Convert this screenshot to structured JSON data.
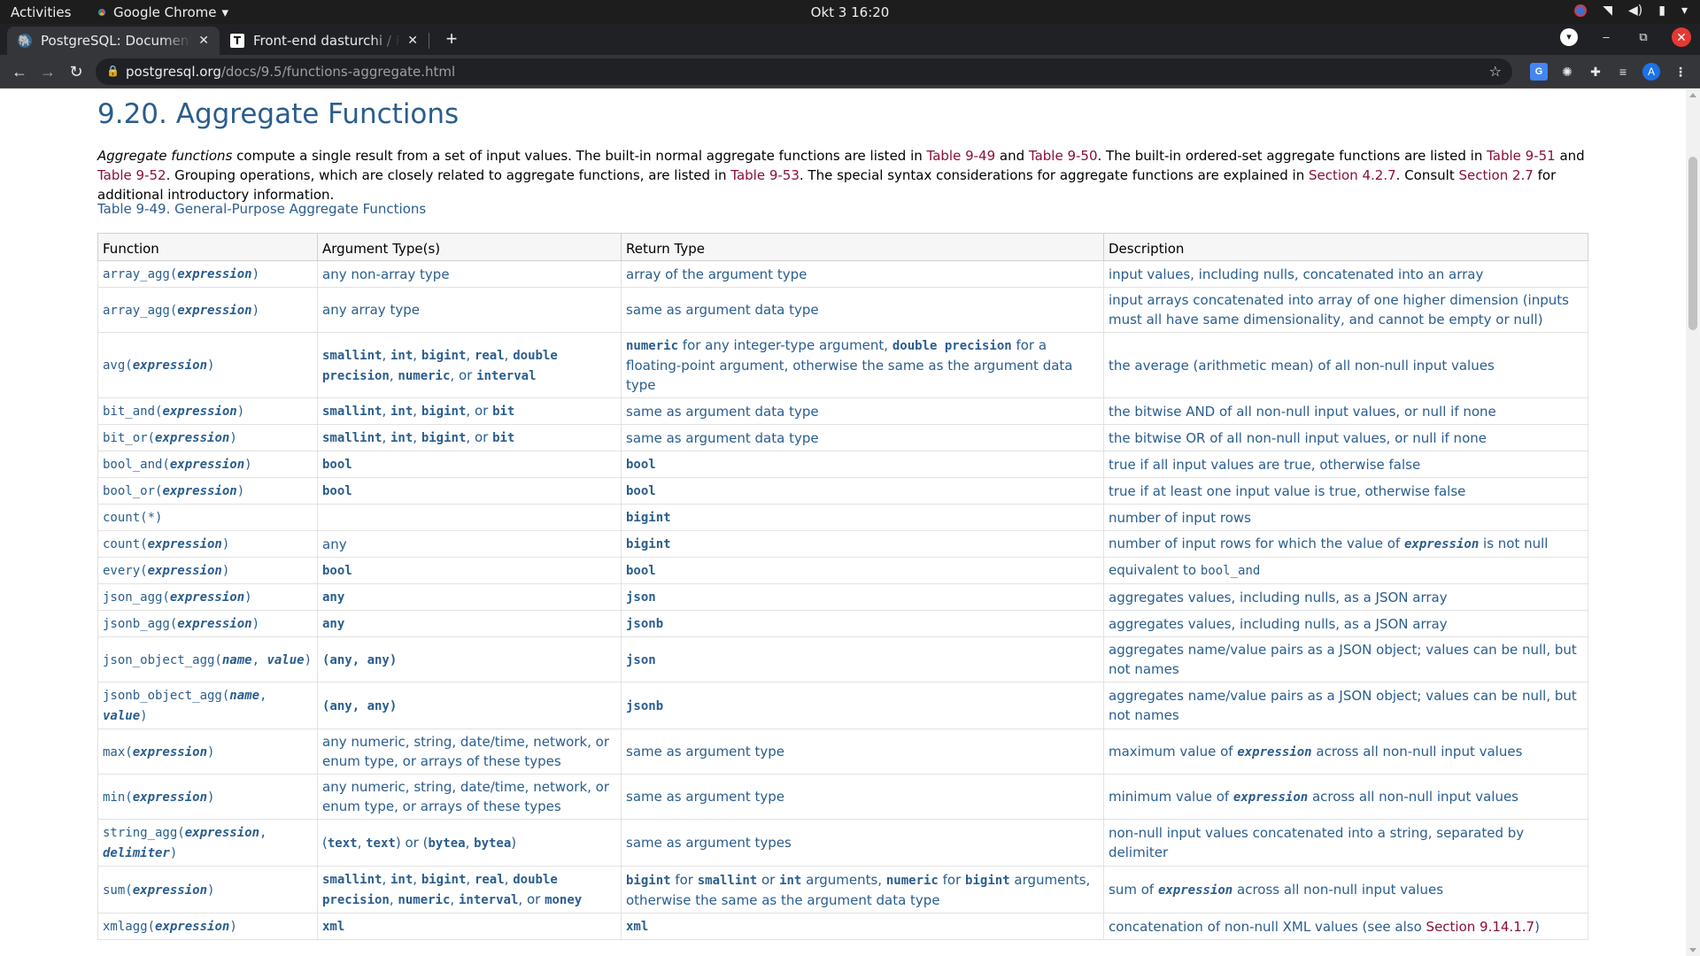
{
  "system_bar": {
    "activities": "Activities",
    "app_name": "Google Chrome",
    "app_caret": "▾",
    "clock": "Okt 3  16:20"
  },
  "tabs": [
    {
      "label": "PostgreSQL: Documentation",
      "favicon": "postgresql-elephant-icon",
      "active": true
    },
    {
      "label": "Front-end dasturchi / Front",
      "favicon": "t-letter-icon",
      "active": false
    }
  ],
  "toolbar": {
    "url_host": "postgresql.org",
    "url_path": "/docs/9.5/functions-aggregate.html"
  },
  "colors": {
    "title": "#2a5d8e",
    "link": "#8b0e3a",
    "chrome_dark": "#202124",
    "chrome_toolbar": "#35363a"
  },
  "page": {
    "title": "9.20. Aggregate Functions",
    "intro": {
      "term": "Aggregate functions",
      "t1": " compute a single result from a set of input values. The built-in normal aggregate functions are listed in ",
      "l1": "Table 9-49",
      "t2": " and ",
      "l2": "Table 9-50",
      "t3": ". The built-in ordered-set aggregate functions are listed in ",
      "l3": "Table 9-51",
      "t4": " and ",
      "l4": "Table 9-52",
      "t5": ". Grouping operations, which are closely related to aggregate functions, are listed in ",
      "l5": "Table 9-53",
      "t6": ". The special syntax considerations for aggregate functions are explained in ",
      "l6": "Section 4.2.7",
      "t7": ". Consult ",
      "l7": "Section 2.7",
      "t8": " for additional introductory information."
    },
    "table_caption": "Table 9-49. General-Purpose Aggregate Functions",
    "columns": [
      "Function",
      "Argument Type(s)",
      "Return Type",
      "Description"
    ],
    "rows": [
      {
        "fn": [
          [
            "m",
            "array_agg("
          ],
          [
            "a",
            "expression"
          ],
          [
            "m",
            ")"
          ]
        ],
        "arg": [
          [
            "t",
            "any non-array type"
          ]
        ],
        "ret": [
          [
            "t",
            "array of the argument type"
          ]
        ],
        "desc": [
          [
            "t",
            "input values, including nulls, concatenated into an array"
          ]
        ]
      },
      {
        "fn": [
          [
            "m",
            "array_agg("
          ],
          [
            "a",
            "expression"
          ],
          [
            "m",
            ")"
          ]
        ],
        "arg": [
          [
            "t",
            "any array type"
          ]
        ],
        "ret": [
          [
            "t",
            "same as argument data type"
          ]
        ],
        "desc": [
          [
            "t",
            "input arrays concatenated into array of one higher dimension (inputs must all have same dimensionality, and cannot be empty or null)"
          ]
        ]
      },
      {
        "fn": [
          [
            "m",
            "avg("
          ],
          [
            "a",
            "expression"
          ],
          [
            "m",
            ")"
          ]
        ],
        "arg": [
          [
            "b",
            "smallint"
          ],
          [
            "t",
            ", "
          ],
          [
            "b",
            "int"
          ],
          [
            "t",
            ", "
          ],
          [
            "b",
            "bigint"
          ],
          [
            "t",
            ", "
          ],
          [
            "b",
            "real"
          ],
          [
            "t",
            ", "
          ],
          [
            "b",
            "double precision"
          ],
          [
            "t",
            ", "
          ],
          [
            "b",
            "numeric"
          ],
          [
            "t",
            ", or "
          ],
          [
            "b",
            "interval"
          ]
        ],
        "ret": [
          [
            "b",
            "numeric"
          ],
          [
            "t",
            " for any integer-type argument, "
          ],
          [
            "b",
            "double precision"
          ],
          [
            "t",
            " for a floating-point argument, otherwise the same as the argument data type"
          ]
        ],
        "desc": [
          [
            "t",
            "the average (arithmetic mean) of all non-null input values"
          ]
        ]
      },
      {
        "fn": [
          [
            "m",
            "bit_and("
          ],
          [
            "a",
            "expression"
          ],
          [
            "m",
            ")"
          ]
        ],
        "arg": [
          [
            "b",
            "smallint"
          ],
          [
            "t",
            ", "
          ],
          [
            "b",
            "int"
          ],
          [
            "t",
            ", "
          ],
          [
            "b",
            "bigint"
          ],
          [
            "t",
            ", or "
          ],
          [
            "b",
            "bit"
          ]
        ],
        "ret": [
          [
            "t",
            "same as argument data type"
          ]
        ],
        "desc": [
          [
            "t",
            "the bitwise AND of all non-null input values, or null if none"
          ]
        ]
      },
      {
        "fn": [
          [
            "m",
            "bit_or("
          ],
          [
            "a",
            "expression"
          ],
          [
            "m",
            ")"
          ]
        ],
        "arg": [
          [
            "b",
            "smallint"
          ],
          [
            "t",
            ", "
          ],
          [
            "b",
            "int"
          ],
          [
            "t",
            ", "
          ],
          [
            "b",
            "bigint"
          ],
          [
            "t",
            ", or "
          ],
          [
            "b",
            "bit"
          ]
        ],
        "ret": [
          [
            "t",
            "same as argument data type"
          ]
        ],
        "desc": [
          [
            "t",
            "the bitwise OR of all non-null input values, or null if none"
          ]
        ]
      },
      {
        "fn": [
          [
            "m",
            "bool_and("
          ],
          [
            "a",
            "expression"
          ],
          [
            "m",
            ")"
          ]
        ],
        "arg": [
          [
            "b",
            "bool"
          ]
        ],
        "ret": [
          [
            "b",
            "bool"
          ]
        ],
        "desc": [
          [
            "t",
            "true if all input values are true, otherwise false"
          ]
        ]
      },
      {
        "fn": [
          [
            "m",
            "bool_or("
          ],
          [
            "a",
            "expression"
          ],
          [
            "m",
            ")"
          ]
        ],
        "arg": [
          [
            "b",
            "bool"
          ]
        ],
        "ret": [
          [
            "b",
            "bool"
          ]
        ],
        "desc": [
          [
            "t",
            "true if at least one input value is true, otherwise false"
          ]
        ]
      },
      {
        "fn": [
          [
            "m",
            "count(*)"
          ]
        ],
        "arg": [],
        "ret": [
          [
            "b",
            "bigint"
          ]
        ],
        "desc": [
          [
            "t",
            "number of input rows"
          ]
        ]
      },
      {
        "fn": [
          [
            "m",
            "count("
          ],
          [
            "a",
            "expression"
          ],
          [
            "m",
            ")"
          ]
        ],
        "arg": [
          [
            "t",
            "any"
          ]
        ],
        "ret": [
          [
            "b",
            "bigint"
          ]
        ],
        "desc": [
          [
            "t",
            "number of input rows for which the value of "
          ],
          [
            "a",
            "expression"
          ],
          [
            "t",
            " is not null"
          ]
        ]
      },
      {
        "fn": [
          [
            "m",
            "every("
          ],
          [
            "a",
            "expression"
          ],
          [
            "m",
            ")"
          ]
        ],
        "arg": [
          [
            "b",
            "bool"
          ]
        ],
        "ret": [
          [
            "b",
            "bool"
          ]
        ],
        "desc": [
          [
            "t",
            "equivalent to "
          ],
          [
            "m",
            "bool_and"
          ]
        ]
      },
      {
        "fn": [
          [
            "m",
            "json_agg("
          ],
          [
            "a",
            "expression"
          ],
          [
            "m",
            ")"
          ]
        ],
        "arg": [
          [
            "b",
            "any"
          ]
        ],
        "ret": [
          [
            "b",
            "json"
          ]
        ],
        "desc": [
          [
            "t",
            "aggregates values, including nulls, as a JSON array"
          ]
        ]
      },
      {
        "fn": [
          [
            "m",
            "jsonb_agg("
          ],
          [
            "a",
            "expression"
          ],
          [
            "m",
            ")"
          ]
        ],
        "arg": [
          [
            "b",
            "any"
          ]
        ],
        "ret": [
          [
            "b",
            "jsonb"
          ]
        ],
        "desc": [
          [
            "t",
            "aggregates values, including nulls, as a JSON array"
          ]
        ]
      },
      {
        "fn": [
          [
            "m",
            "json_object_agg("
          ],
          [
            "a",
            "name"
          ],
          [
            "m",
            ", "
          ],
          [
            "a",
            "value"
          ],
          [
            "m",
            ")"
          ]
        ],
        "arg": [
          [
            "b",
            "(any, any)"
          ]
        ],
        "ret": [
          [
            "b",
            "json"
          ]
        ],
        "desc": [
          [
            "t",
            "aggregates name/value pairs as a JSON object; values can be null, but not names"
          ]
        ]
      },
      {
        "fn": [
          [
            "m",
            "jsonb_object_agg("
          ],
          [
            "a",
            "name"
          ],
          [
            "m",
            ", "
          ],
          [
            "a",
            "value"
          ],
          [
            "m",
            ")"
          ]
        ],
        "arg": [
          [
            "b",
            "(any, any)"
          ]
        ],
        "ret": [
          [
            "b",
            "jsonb"
          ]
        ],
        "desc": [
          [
            "t",
            "aggregates name/value pairs as a JSON object; values can be null, but not names"
          ]
        ]
      },
      {
        "fn": [
          [
            "m",
            "max("
          ],
          [
            "a",
            "expression"
          ],
          [
            "m",
            ")"
          ]
        ],
        "arg": [
          [
            "t",
            "any numeric, string, date/time, network, or enum type, or arrays of these types"
          ]
        ],
        "ret": [
          [
            "t",
            "same as argument type"
          ]
        ],
        "desc": [
          [
            "t",
            "maximum value of "
          ],
          [
            "a",
            "expression"
          ],
          [
            "t",
            " across all non-null input values"
          ]
        ]
      },
      {
        "fn": [
          [
            "m",
            "min("
          ],
          [
            "a",
            "expression"
          ],
          [
            "m",
            ")"
          ]
        ],
        "arg": [
          [
            "t",
            "any numeric, string, date/time, network, or enum type, or arrays of these types"
          ]
        ],
        "ret": [
          [
            "t",
            "same as argument type"
          ]
        ],
        "desc": [
          [
            "t",
            "minimum value of "
          ],
          [
            "a",
            "expression"
          ],
          [
            "t",
            " across all non-null input values"
          ]
        ]
      },
      {
        "fn": [
          [
            "m",
            "string_agg("
          ],
          [
            "a",
            "expression"
          ],
          [
            "m",
            ", "
          ],
          [
            "a",
            "delimiter"
          ],
          [
            "m",
            ")"
          ]
        ],
        "arg": [
          [
            "t",
            "("
          ],
          [
            "b",
            "text"
          ],
          [
            "t",
            ", "
          ],
          [
            "b",
            "text"
          ],
          [
            "t",
            ") or ("
          ],
          [
            "b",
            "bytea"
          ],
          [
            "t",
            ", "
          ],
          [
            "b",
            "bytea"
          ],
          [
            "t",
            ")"
          ]
        ],
        "ret": [
          [
            "t",
            "same as argument types"
          ]
        ],
        "desc": [
          [
            "t",
            "non-null input values concatenated into a string, separated by delimiter"
          ]
        ]
      },
      {
        "fn": [
          [
            "m",
            "sum("
          ],
          [
            "a",
            "expression"
          ],
          [
            "m",
            ")"
          ]
        ],
        "arg": [
          [
            "b",
            "smallint"
          ],
          [
            "t",
            ", "
          ],
          [
            "b",
            "int"
          ],
          [
            "t",
            ", "
          ],
          [
            "b",
            "bigint"
          ],
          [
            "t",
            ", "
          ],
          [
            "b",
            "real"
          ],
          [
            "t",
            ", "
          ],
          [
            "b",
            "double precision"
          ],
          [
            "t",
            ", "
          ],
          [
            "b",
            "numeric"
          ],
          [
            "t",
            ", "
          ],
          [
            "b",
            "interval"
          ],
          [
            "t",
            ", or "
          ],
          [
            "b",
            "money"
          ]
        ],
        "ret": [
          [
            "b",
            "bigint"
          ],
          [
            "t",
            " for "
          ],
          [
            "b",
            "smallint"
          ],
          [
            "t",
            " or "
          ],
          [
            "b",
            "int"
          ],
          [
            "t",
            " arguments, "
          ],
          [
            "b",
            "numeric"
          ],
          [
            "t",
            " for "
          ],
          [
            "b",
            "bigint"
          ],
          [
            "t",
            " arguments, otherwise the same as the argument data type"
          ]
        ],
        "desc": [
          [
            "t",
            "sum of "
          ],
          [
            "a",
            "expression"
          ],
          [
            "t",
            " across all non-null input values"
          ]
        ]
      },
      {
        "fn": [
          [
            "m",
            "xmlagg("
          ],
          [
            "a",
            "expression"
          ],
          [
            "m",
            ")"
          ]
        ],
        "arg": [
          [
            "b",
            "xml"
          ]
        ],
        "ret": [
          [
            "b",
            "xml"
          ]
        ],
        "desc": [
          [
            "t",
            "concatenation of non-null XML values (see also "
          ],
          [
            "l",
            "Section 9.14.1.7"
          ],
          [
            "t",
            ")"
          ]
        ]
      }
    ]
  }
}
